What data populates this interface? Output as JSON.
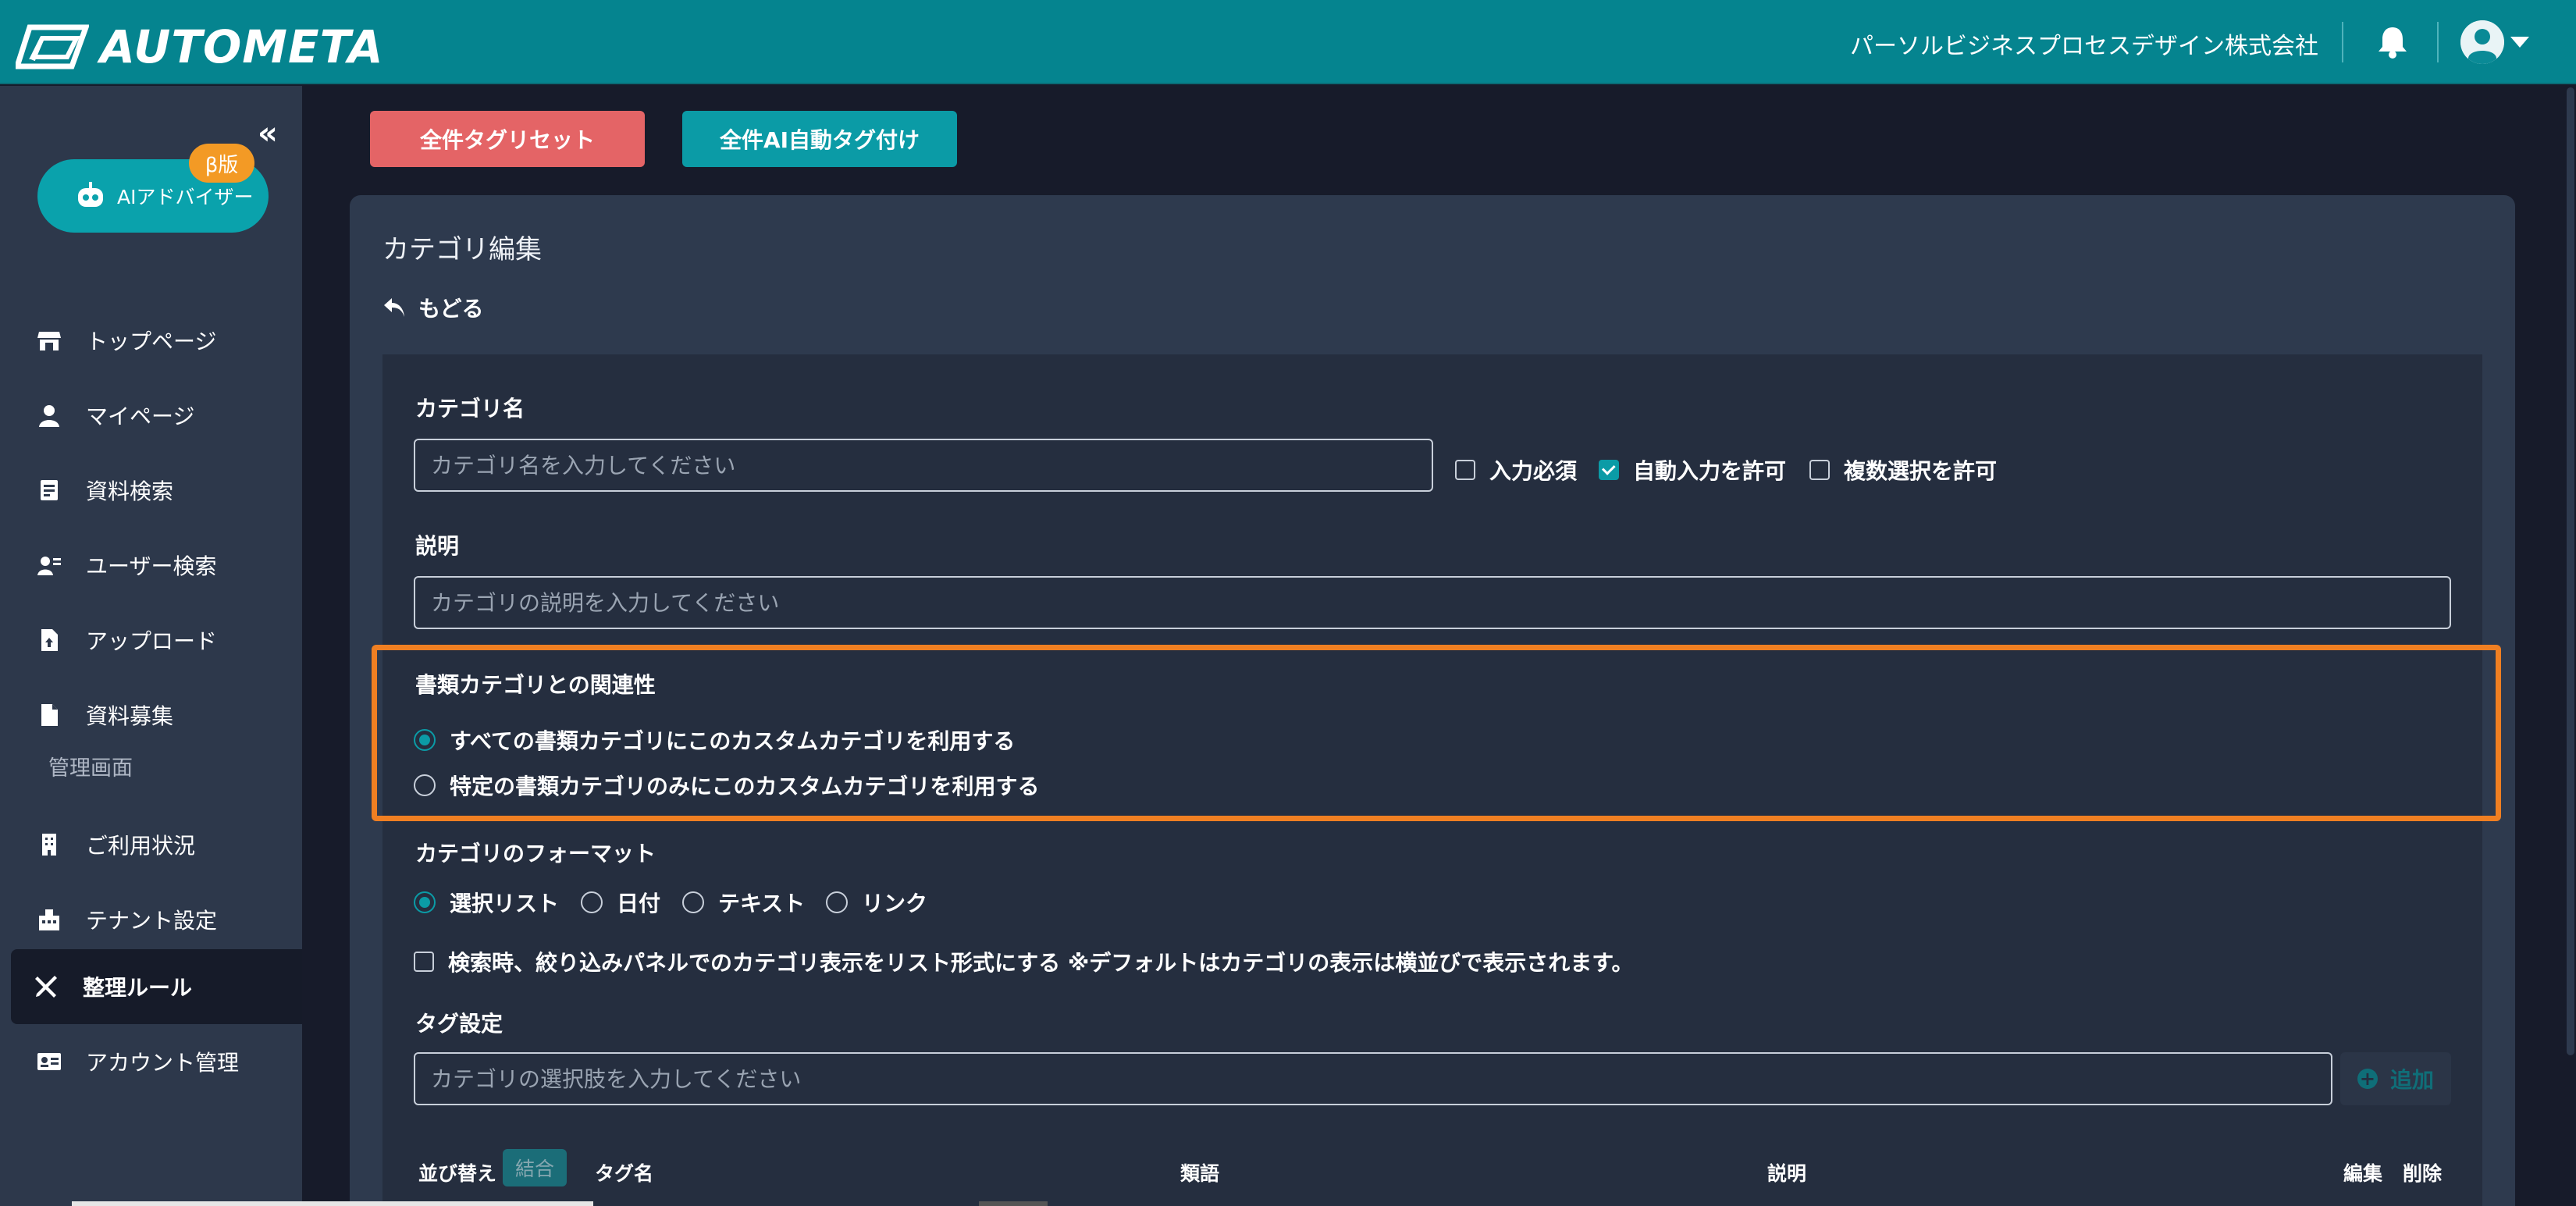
{
  "header": {
    "logo_text": "AUTOMETA",
    "company": "パーソルビジネスプロセスデザイン株式会社",
    "icons": [
      "logo-mark",
      "bell-icon",
      "user-avatar-icon",
      "caret-down-icon"
    ]
  },
  "sidebar": {
    "collapse_glyph": "«",
    "ai_button": {
      "label": "AIアドバイザー",
      "badge": "β版"
    },
    "items": [
      {
        "label": "トップページ",
        "icon": "store-icon"
      },
      {
        "label": "マイページ",
        "icon": "person-icon"
      },
      {
        "label": "資料検索",
        "icon": "document-search-icon"
      },
      {
        "label": "ユーザー検索",
        "icon": "user-search-icon"
      },
      {
        "label": "アップロード",
        "icon": "upload-file-icon"
      },
      {
        "label": "資料募集",
        "icon": "file-icon"
      }
    ],
    "section_label": "管理画面",
    "admin_items": [
      {
        "label": "ご利用状況",
        "icon": "building-icon"
      },
      {
        "label": "テナント設定",
        "icon": "tenant-icon"
      },
      {
        "label": "整理ルール",
        "icon": "tools-icon",
        "active": true
      },
      {
        "label": "アカウント管理",
        "icon": "id-card-icon"
      }
    ]
  },
  "toolbar": {
    "reset_all": "全件タグリセット",
    "ai_tag_all": "全件AI自動タグ付け"
  },
  "panel": {
    "title": "カテゴリ編集",
    "back": "もどる",
    "category_name": {
      "label": "カテゴリ名",
      "placeholder": "カテゴリ名を入力してください",
      "value": ""
    },
    "checkboxes": [
      {
        "label": "入力必須",
        "checked": false
      },
      {
        "label": "自動入力を許可",
        "checked": true
      },
      {
        "label": "複数選択を許可",
        "checked": false
      }
    ],
    "description": {
      "label": "説明",
      "placeholder": "カテゴリの説明を入力してください",
      "value": ""
    },
    "relation": {
      "label": "書類カテゴリとの関連性",
      "options": [
        {
          "label": "すべての書類カテゴリにこのカスタムカテゴリを利用する",
          "selected": true
        },
        {
          "label": "特定の書類カテゴリのみにこのカスタムカテゴリを利用する",
          "selected": false
        }
      ]
    },
    "format": {
      "label": "カテゴリのフォーマット",
      "options": [
        {
          "label": "選択リスト",
          "selected": true
        },
        {
          "label": "日付",
          "selected": false
        },
        {
          "label": "テキスト",
          "selected": false
        },
        {
          "label": "リンク",
          "selected": false
        }
      ]
    },
    "list_display": {
      "label": "検索時、絞り込みパネルでのカテゴリ表示をリスト形式にする ※デフォルトはカテゴリの表示は横並びで表示されます。",
      "checked": false
    },
    "tag_settings": {
      "label": "タグ設定",
      "placeholder": "カテゴリの選択肢を入力してください",
      "add_label": "追加"
    },
    "table_headers": {
      "sort": "並び替え",
      "merge": "結合",
      "tag_name": "タグ名",
      "synonyms": "類語",
      "description": "説明",
      "edit": "編集",
      "delete": "削除"
    }
  },
  "colors": {
    "header_bg": "#05848f",
    "sidebar_bg": "#2d384b",
    "accent": "#0b9ba6",
    "danger": "#e46466",
    "highlight": "#f07f22",
    "badge": "#f39a25"
  }
}
